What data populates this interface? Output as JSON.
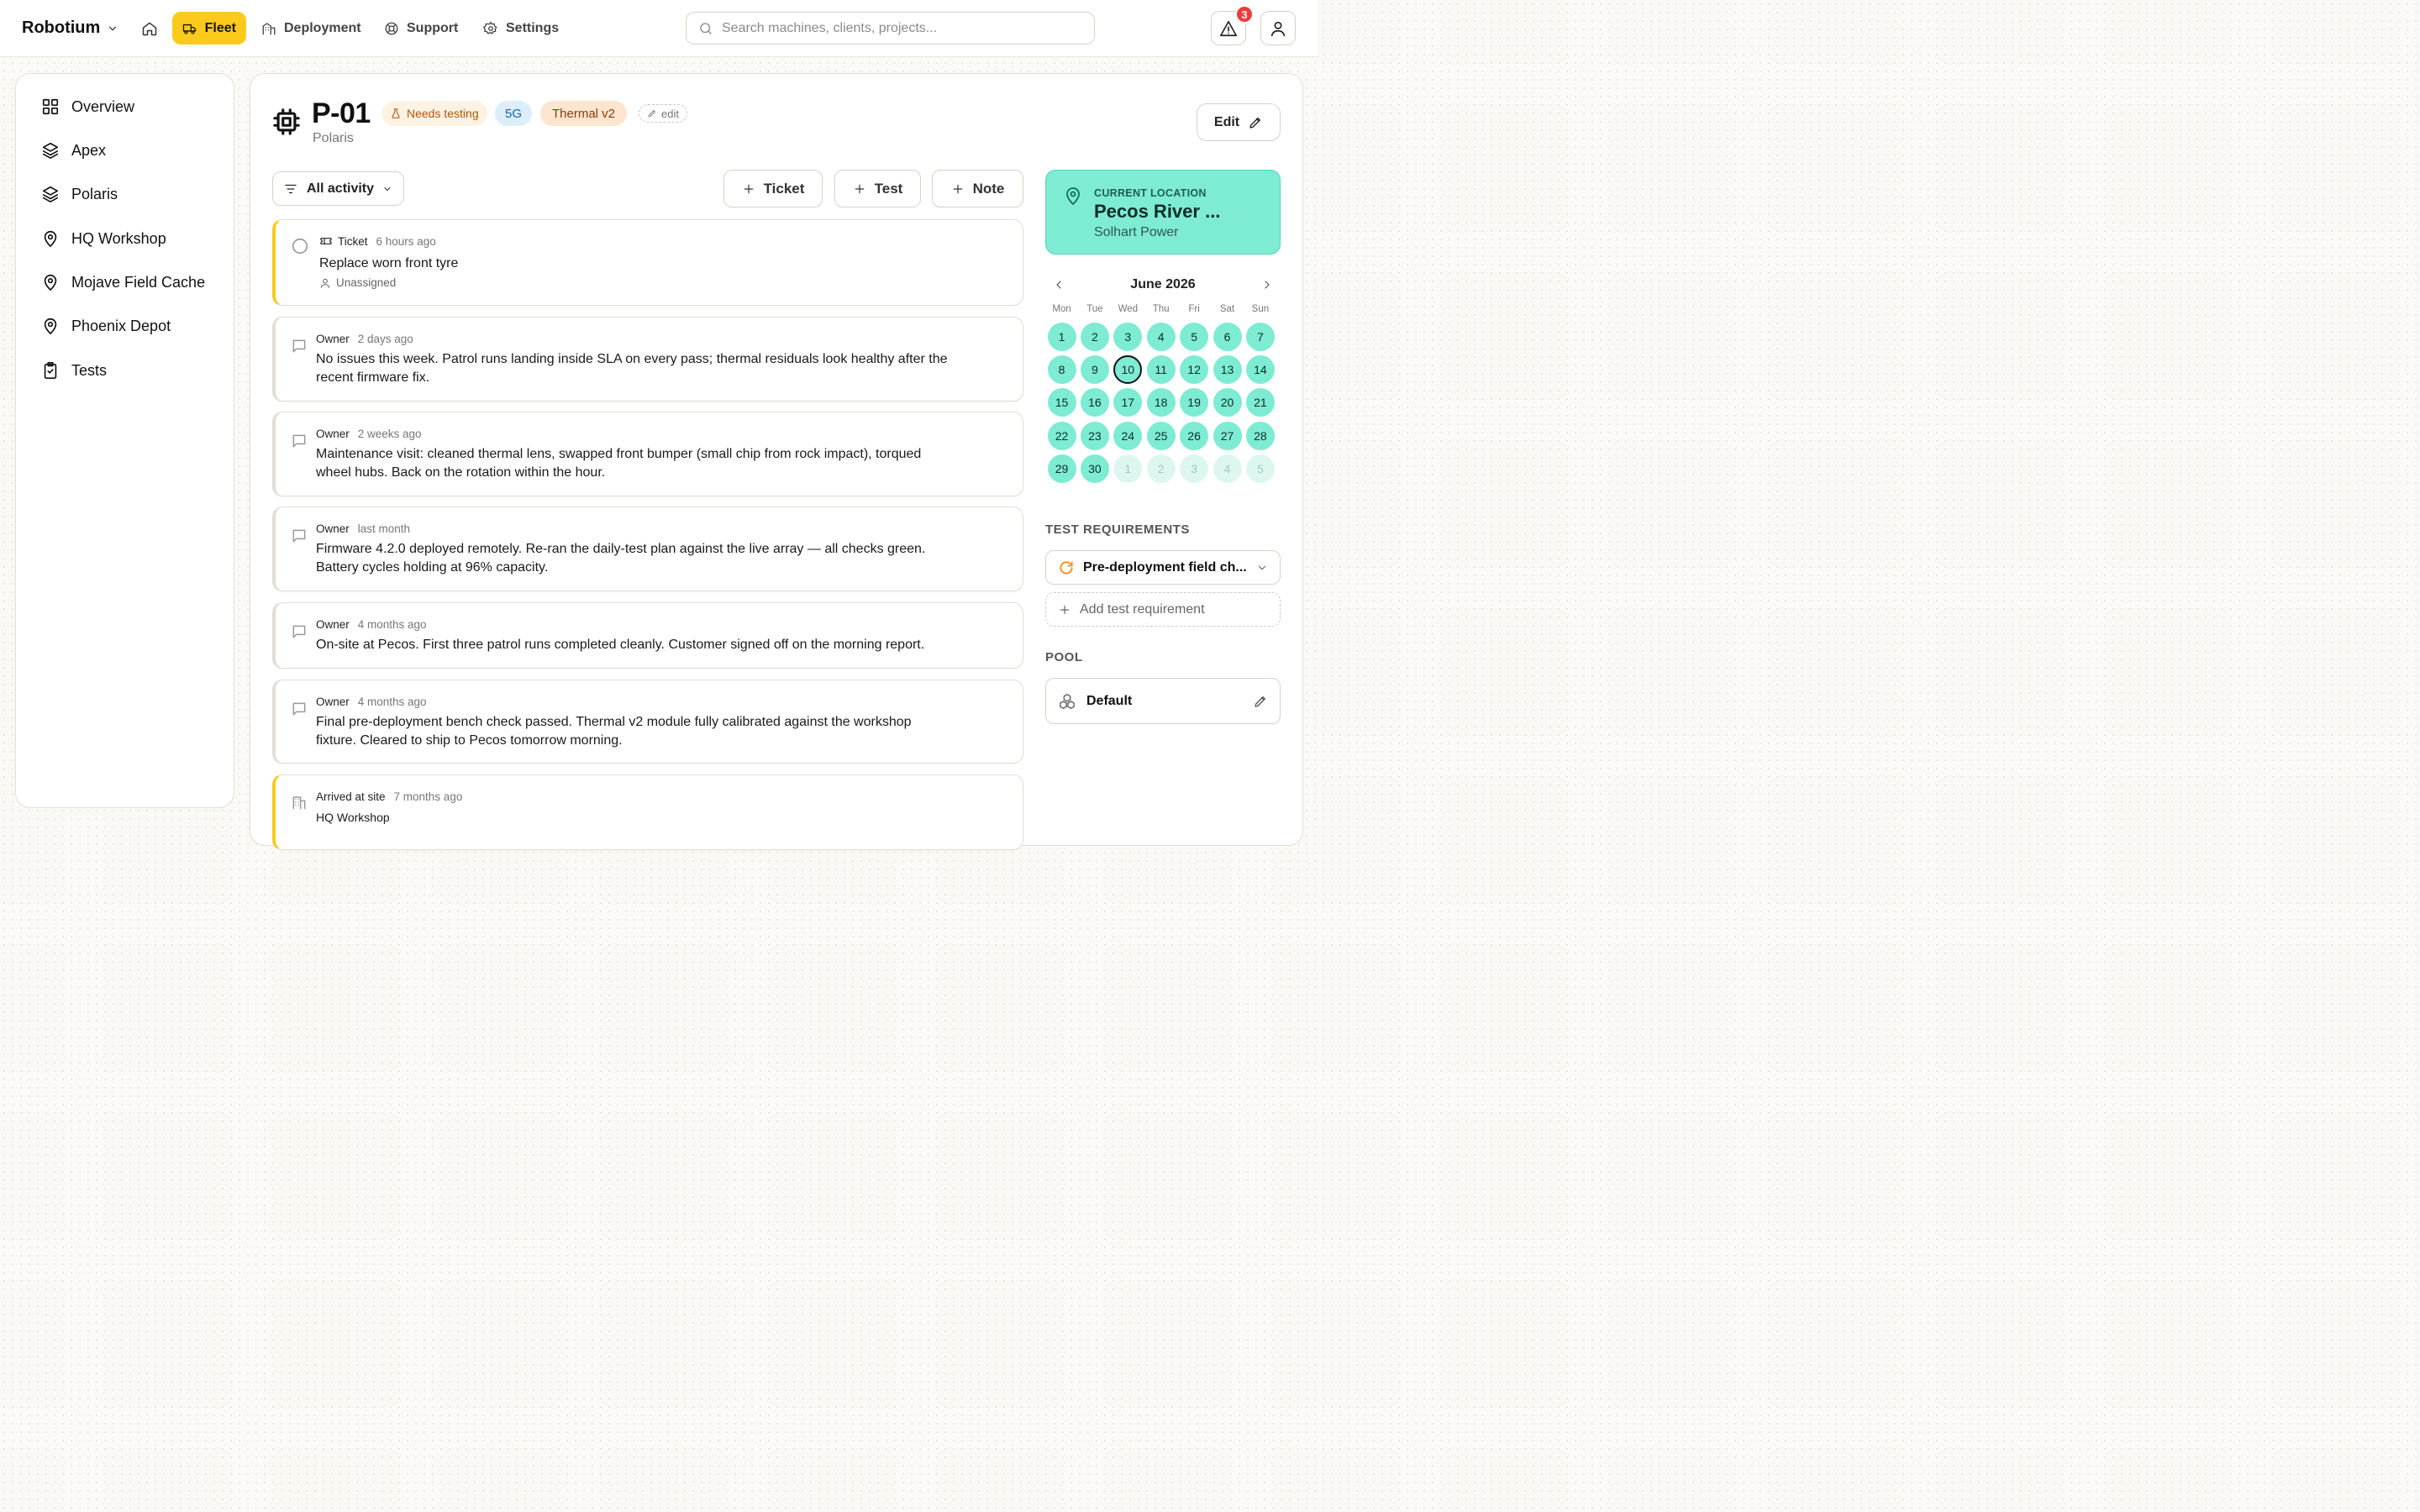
{
  "topbar": {
    "brand": "Robotium",
    "nav": [
      {
        "label": "Fleet",
        "active": true
      },
      {
        "label": "Deployment"
      },
      {
        "label": "Support"
      },
      {
        "label": "Settings"
      }
    ],
    "search_placeholder": "Search machines, clients, projects...",
    "alerts_count": "3"
  },
  "sidebar": {
    "items": [
      {
        "label": "Overview",
        "icon": "grid-icon"
      },
      {
        "label": "Apex",
        "icon": "layers-icon"
      },
      {
        "label": "Polaris",
        "icon": "layers-icon"
      },
      {
        "label": "HQ Workshop",
        "icon": "location-pin-icon"
      },
      {
        "label": "Mojave Field Cache",
        "icon": "location-pin-icon"
      },
      {
        "label": "Phoenix Depot",
        "icon": "location-pin-icon"
      },
      {
        "label": "Tests",
        "icon": "clipboard-check-icon"
      }
    ]
  },
  "machine": {
    "id": "P-01",
    "project": "Polaris",
    "tags": {
      "status": "Needs testing",
      "network": "5G",
      "module": "Thermal v2",
      "edit": "edit"
    },
    "edit_label": "Edit"
  },
  "activity": {
    "filter_label": "All activity",
    "actions": {
      "ticket": "Ticket",
      "test": "Test",
      "note": "Note"
    },
    "items": [
      {
        "type": "Ticket",
        "time": "6 hours ago",
        "title": "Replace worn front tyre",
        "assignee": "Unassigned"
      },
      {
        "author": "Owner",
        "time": "2 days ago",
        "text": "No issues this week. Patrol runs landing inside SLA on every pass; thermal residuals look healthy after the recent firmware fix."
      },
      {
        "author": "Owner",
        "time": "2 weeks ago",
        "text": "Maintenance visit: cleaned thermal lens, swapped front bumper (small chip from rock impact), torqued wheel hubs. Back on the rotation within the hour."
      },
      {
        "author": "Owner",
        "time": "last month",
        "text": "Firmware 4.2.0 deployed remotely. Re-ran the daily-test plan against the live array — all checks green. Battery cycles holding at 96% capacity."
      },
      {
        "author": "Owner",
        "time": "4 months ago",
        "text": "On-site at Pecos. First three patrol runs completed cleanly. Customer signed off on the morning report."
      },
      {
        "author": "Owner",
        "time": "4 months ago",
        "text": "Final pre-deployment bench check passed. Thermal v2 module fully calibrated against the workshop fixture. Cleared to ship to Pecos tomorrow morning."
      },
      {
        "event": "Arrived at site",
        "time": "7 months ago",
        "site": "HQ Workshop"
      }
    ]
  },
  "location": {
    "label": "CURRENT LOCATION",
    "name": "Pecos River ...",
    "client": "Solhart Power"
  },
  "calendar": {
    "month": "June 2026",
    "weekdays": [
      "Mon",
      "Tue",
      "Wed",
      "Thu",
      "Fri",
      "Sat",
      "Sun"
    ],
    "days": [
      "1",
      "2",
      "3",
      "4",
      "5",
      "6",
      "7",
      "8",
      "9",
      "10",
      "11",
      "12",
      "13",
      "14",
      "15",
      "16",
      "17",
      "18",
      "19",
      "20",
      "21",
      "22",
      "23",
      "24",
      "25",
      "26",
      "27",
      "28",
      "29",
      "30"
    ],
    "trailing_days": [
      "1",
      "2",
      "3",
      "4",
      "5"
    ],
    "today": "10"
  },
  "test_requirements": {
    "label": "TEST REQUIREMENTS",
    "selected": "Pre-deployment field ch...",
    "add_label": "Add test requirement"
  },
  "pool": {
    "label": "POOL",
    "value": "Default"
  },
  "colors": {
    "accent": "#fbca1c",
    "teal": "#7eebd3",
    "alert": "#ef3b3b"
  }
}
